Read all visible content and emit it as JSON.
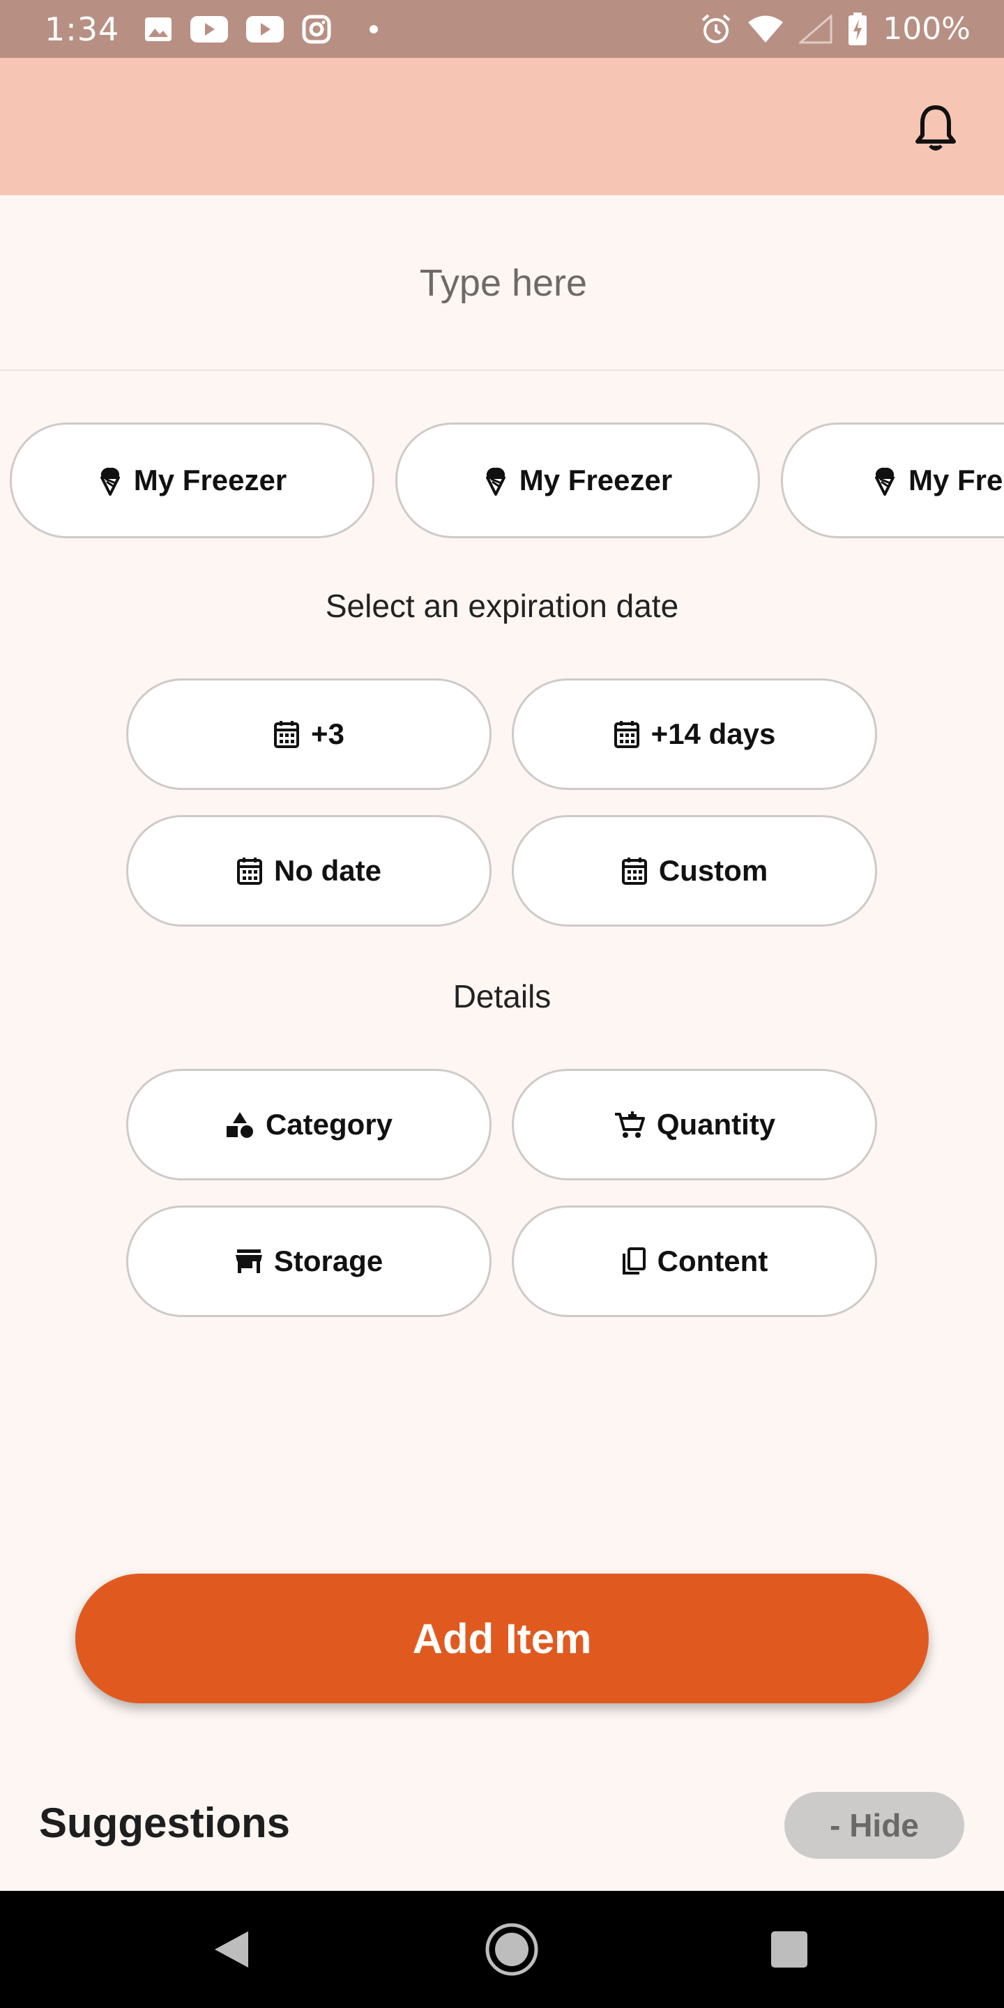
{
  "status_bar": {
    "time": "1:34",
    "battery": "100%",
    "icons": [
      "image-icon",
      "youtube-icon",
      "youtube-icon",
      "instagram-icon",
      "dot-icon",
      "alarm-icon",
      "wifi-icon",
      "signal-icon",
      "battery-charging-icon"
    ]
  },
  "app_bar": {
    "color": "#f7c5b4",
    "notification_icon": "bell-icon"
  },
  "search": {
    "placeholder": "Type here"
  },
  "locations": [
    {
      "label": "My Freezer",
      "icon": "ice-cream-icon"
    },
    {
      "label": "My Freezer",
      "icon": "ice-cream-icon"
    },
    {
      "label": "My Freezer",
      "icon": "ice-cream-icon"
    }
  ],
  "expiration": {
    "title": "Select an expiration date",
    "options": [
      {
        "label": "+3",
        "icon": "calendar-icon"
      },
      {
        "label": "+14 days",
        "icon": "calendar-icon"
      },
      {
        "label": "No date",
        "icon": "calendar-icon"
      },
      {
        "label": "Custom",
        "icon": "calendar-icon"
      }
    ]
  },
  "details": {
    "title": "Details",
    "options": [
      {
        "label": "Category",
        "icon": "shapes-icon"
      },
      {
        "label": "Quantity",
        "icon": "cart-icon"
      },
      {
        "label": "Storage",
        "icon": "store-icon"
      },
      {
        "label": "Content",
        "icon": "copy-icon"
      }
    ]
  },
  "add_button": {
    "label": "Add Item",
    "color": "#e05a20"
  },
  "suggestions": {
    "title": "Suggestions",
    "hide_label": "- Hide"
  },
  "nav_bar": {
    "icons": [
      "back-icon",
      "home-icon",
      "recents-icon"
    ]
  }
}
